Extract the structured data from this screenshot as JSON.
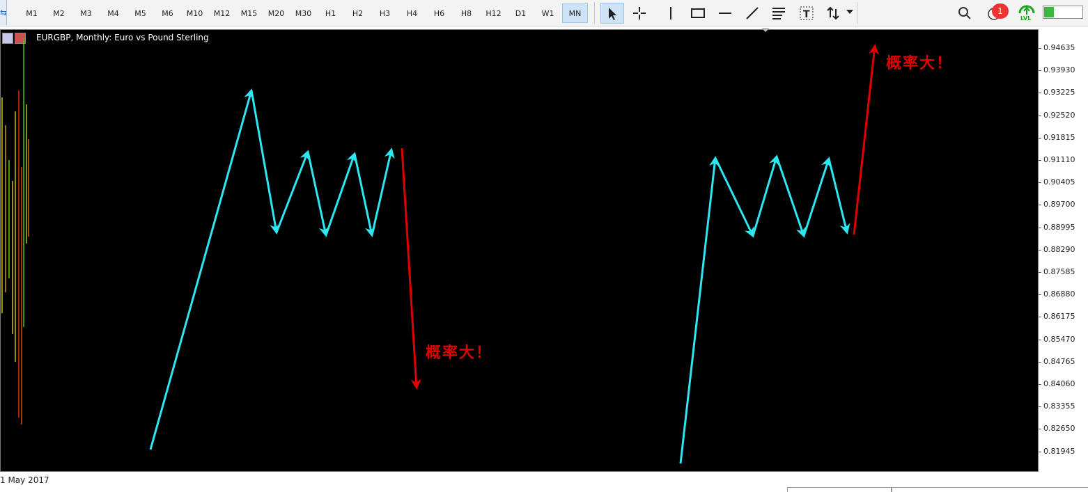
{
  "toolbar": {
    "timeframes": [
      "M1",
      "M2",
      "M3",
      "M4",
      "M5",
      "M6",
      "M10",
      "M12",
      "M15",
      "M20",
      "M30",
      "H1",
      "H2",
      "H3",
      "H4",
      "H6",
      "H8",
      "H12",
      "D1",
      "W1",
      "MN"
    ],
    "active_timeframe": "MN",
    "tools": [
      "cursor-icon",
      "crosshair-icon",
      "vertical-line-icon",
      "rectangle-icon",
      "horizontal-line-icon",
      "trendline-icon",
      "fibonacci-icon",
      "text-icon",
      "arrows-icon"
    ],
    "notification_count": "1",
    "signal_label": "LVL",
    "battery_level": 0.25
  },
  "chart": {
    "title": "EURGBP, Monthly:  Euro vs Pound Sterling",
    "date_label": "1 May 2017",
    "price_scale": [
      "0.94635",
      "0.93930",
      "0.93225",
      "0.92520",
      "0.91815",
      "0.91110",
      "0.90405",
      "0.89700",
      "0.88995",
      "0.88290",
      "0.87585",
      "0.86880",
      "0.86175",
      "0.85470",
      "0.84765",
      "0.84060",
      "0.83355",
      "0.82650",
      "0.81945"
    ],
    "annotation_left": "概率大！",
    "annotation_right": "概率大！",
    "colors": {
      "background": "#000000",
      "pattern_arrows": "#2ee6f0",
      "prediction_arrows": "#e00000",
      "annotation_text": "#e00000"
    }
  }
}
